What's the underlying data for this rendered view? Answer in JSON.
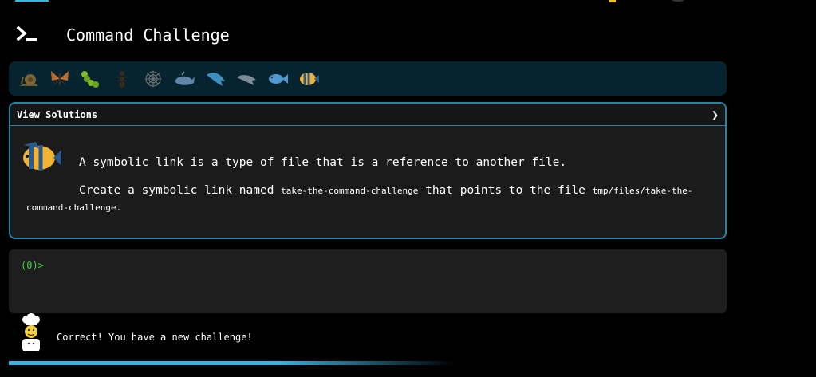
{
  "app": {
    "title": "Command Challenge"
  },
  "animals": [
    "snail-icon",
    "butterfly-icon",
    "caterpillar-icon",
    "ant-icon",
    "spider-web-icon",
    "whale-icon",
    "dolphin-icon",
    "dolphin-grey-icon",
    "fish-icon",
    "tropical-fish-icon"
  ],
  "challenge": {
    "header_label": "View Solutions",
    "chevron": "❯",
    "line1": "A symbolic link is a type of file that is a reference to another file.",
    "line2_prefix": "Create a symbolic link named ",
    "link_name": "take-the-command-challenge",
    "line2_middle": " that points to the file ",
    "target_path": "tmp/files/take-the-command-challenge",
    "line2_suffix": "."
  },
  "console": {
    "prompt": "(0)>"
  },
  "status": {
    "message": "Correct! You have a new challenge!"
  },
  "colors": {
    "accent": "#36b5e4",
    "prompt": "#3ed43e",
    "bar_bg": "#062330"
  }
}
